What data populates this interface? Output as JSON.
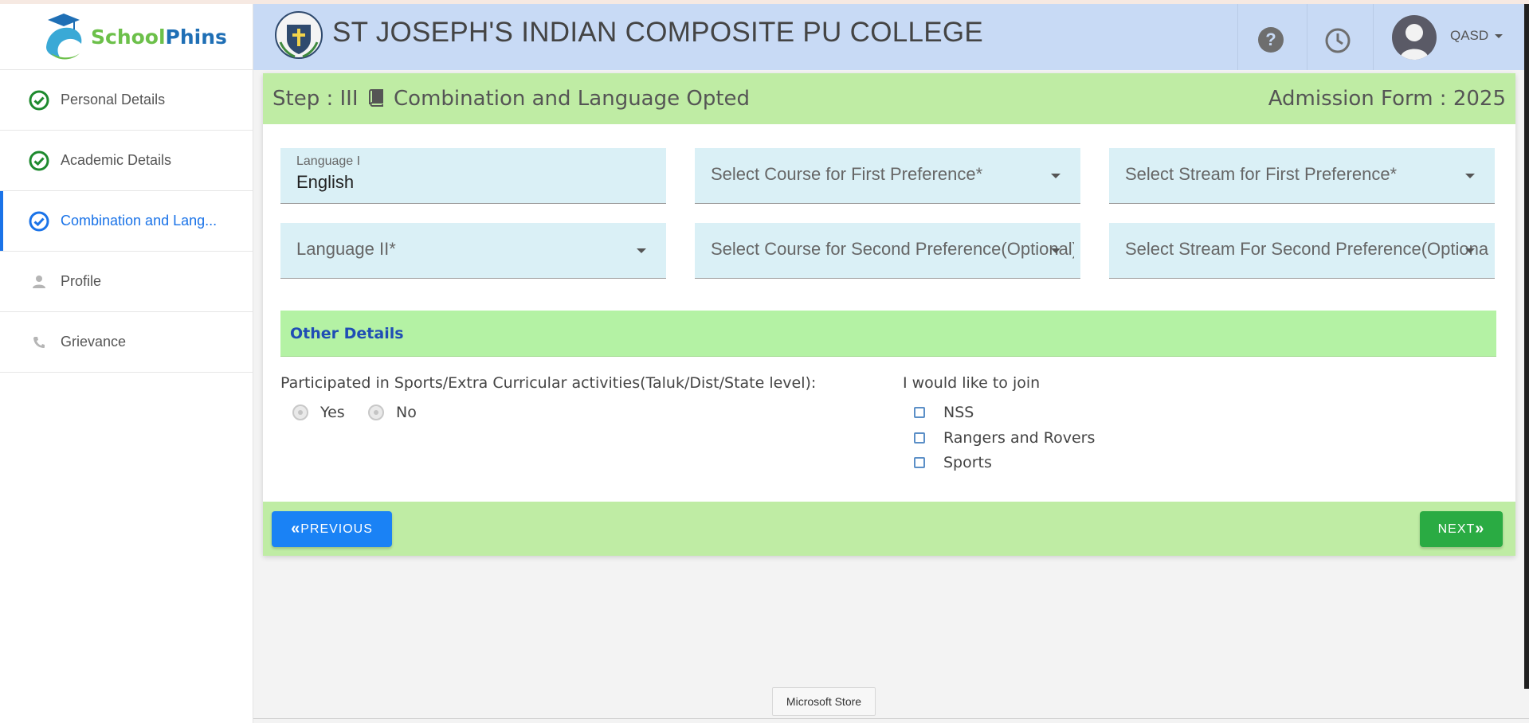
{
  "brand": {
    "part1": "School",
    "part2": "Phins"
  },
  "sidebar": {
    "items": [
      {
        "label": "Personal Details"
      },
      {
        "label": "Academic Details"
      },
      {
        "label": "Combination and Lang..."
      },
      {
        "label": "Profile"
      },
      {
        "label": "Grievance"
      }
    ]
  },
  "header": {
    "college": "ST JOSEPH'S INDIAN COMPOSITE PU COLLEGE",
    "help": "?",
    "user": "QASD"
  },
  "form": {
    "step_prefix": "Step : III",
    "step_title": "Combination and Language Opted",
    "admission": "Admission Form : 2025",
    "language1": {
      "label": "Language I",
      "value": "English"
    },
    "course_first": "Select Course for First Preference*",
    "stream_first": "Select Stream for First Preference*",
    "language2": "Language II*",
    "course_second": "Select Course for Second Preference(Optional)",
    "stream_second": "Select Stream For Second Preference(Optional)",
    "other_details": "Other Details",
    "participated_q": "Participated in Sports/Extra Curricular activities(Taluk/Dist/State level):",
    "yes": "Yes",
    "no": "No",
    "join_q": "I would like to join",
    "join_options": [
      "NSS",
      "Rangers and Rovers",
      "Sports"
    ],
    "prev": "PREVIOUS",
    "next": "NEXT"
  },
  "taskbar_tip": "Microsoft Store",
  "colors": {
    "accent": "#1a73e8",
    "header_bg": "#c8daf5",
    "green_band": "#bfeca4",
    "prev_btn": "#1a82f5",
    "next_btn": "#2aab43"
  }
}
